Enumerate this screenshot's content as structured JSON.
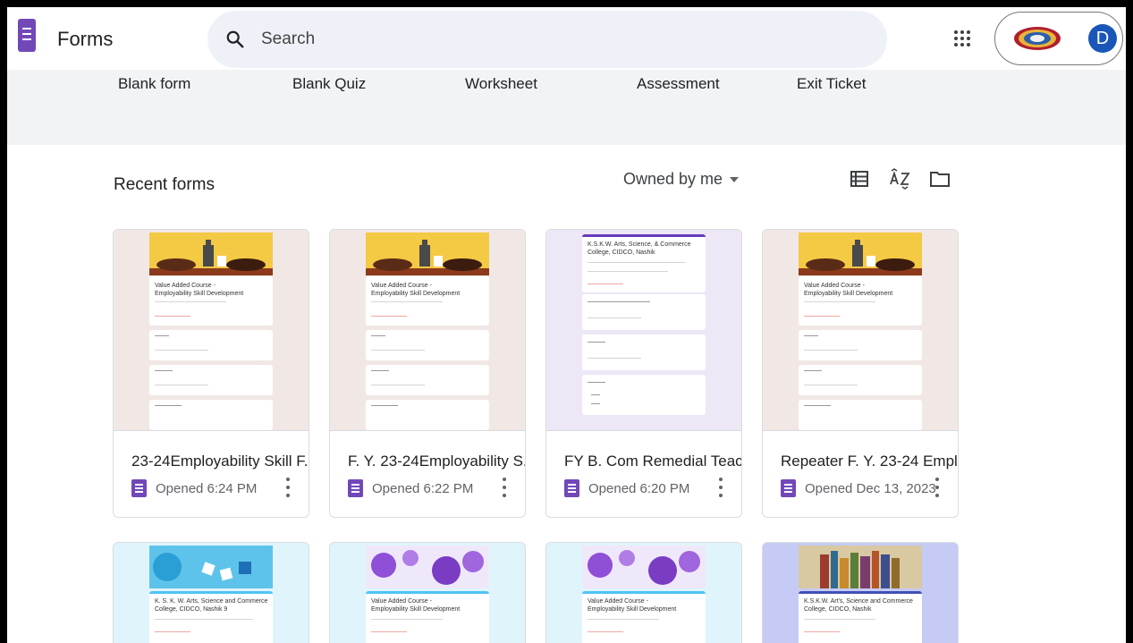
{
  "app": {
    "title": "Forms"
  },
  "search": {
    "placeholder": "Search"
  },
  "account": {
    "avatar_letter": "D"
  },
  "templates": [
    {
      "label": "Blank form"
    },
    {
      "label": "Blank Quiz"
    },
    {
      "label": "Worksheet"
    },
    {
      "label": "Assessment"
    },
    {
      "label": "Exit Ticket"
    }
  ],
  "recent": {
    "title": "Recent forms",
    "filter": "Owned by me"
  },
  "cards": [
    {
      "title": "23-24Employability Skill F....",
      "opened": "Opened 6:24 PM",
      "thumb_lines": [
        "Value Added Course -",
        "Employability Skill Development"
      ]
    },
    {
      "title": "F. Y. 23-24Employability S...",
      "opened": "Opened 6:22 PM",
      "thumb_lines": [
        "Value Added Course -",
        "Employability Skill Development"
      ]
    },
    {
      "title": "FY B. Com Remedial Teac...",
      "opened": "Opened 6:20 PM",
      "thumb_lines": [
        "K.S.K.W. Arts,  Science, & Commerce",
        "College, CIDCO, Nashik"
      ]
    },
    {
      "title": "Repeater F. Y. 23-24 Empl...",
      "opened": "Opened Dec 13, 2023",
      "thumb_lines": [
        "Value Added Course -",
        "Employability Skill Development"
      ]
    }
  ],
  "bottom_cards": [
    {
      "thumb_lines": [
        "K. S. K. W. Arts, Science and Commerce",
        "College, CIDCO, Nashik 9"
      ]
    },
    {
      "thumb_lines": [
        "Value Added Course -",
        "Employability Skill Development"
      ]
    },
    {
      "thumb_lines": [
        "Value Added Course -",
        "Employability Skill Development"
      ]
    },
    {
      "thumb_lines": [
        "K.S.K.W. Art's, Science and Commerce",
        "College, CIDCO, Nashik"
      ]
    }
  ],
  "colors": {
    "brand": "#7248b9",
    "avatar": "#1a56b8",
    "search_bg": "#eef2f8",
    "template_strip": "#f1f3f4"
  }
}
